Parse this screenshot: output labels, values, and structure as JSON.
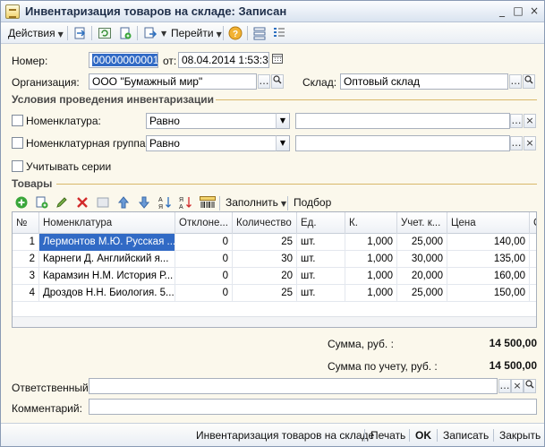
{
  "window": {
    "title": "Инвентаризация товаров на складе: Записан",
    "btn_minimize": "_",
    "btn_maximize": "□",
    "btn_close": "×"
  },
  "toolbar": {
    "actions_label": "Действия",
    "goto_label": "Перейти"
  },
  "header": {
    "number_label": "Номер:",
    "number_value": "00000000001",
    "date_label": "от:",
    "date_value": "08.04.2014  1:53:37",
    "org_label": "Организация:",
    "org_value": "ООО \"Бумажный мир\"",
    "warehouse_label": "Склад:",
    "warehouse_value": "Оптовый склад"
  },
  "conditions": {
    "title": "Условия проведения инвентаризации",
    "nomenclature_label": "Номенклатура:",
    "nomenclature_mode": "Равно",
    "nomenclature_value": "",
    "group_label": "Номенклатурная группа:",
    "group_mode": "Равно",
    "group_value": "",
    "series_label": "Учитывать серии"
  },
  "goods": {
    "title": "Товары",
    "fill_label": "Заполнить",
    "select_label": "Подбор",
    "columns": [
      "№",
      "Номенклатура",
      "Отклоне...",
      "Количество",
      "Ед.",
      "К.",
      "Учет. к...",
      "Цена",
      "С"
    ],
    "rows": [
      {
        "n": "1",
        "name": "Лермонтов М.Ю. Русская ...",
        "dev": "0",
        "qty": "25",
        "unit": "шт.",
        "k": "1,000",
        "acc": "25,000",
        "price": "140,00"
      },
      {
        "n": "2",
        "name": "Карнеги Д. Английский я...",
        "dev": "0",
        "qty": "30",
        "unit": "шт.",
        "k": "1,000",
        "acc": "30,000",
        "price": "135,00"
      },
      {
        "n": "3",
        "name": "Карамзин Н.М. История Р...",
        "dev": "0",
        "qty": "20",
        "unit": "шт.",
        "k": "1,000",
        "acc": "20,000",
        "price": "160,00"
      },
      {
        "n": "4",
        "name": "Дроздов Н.Н. Биология. 5...",
        "dev": "0",
        "qty": "25",
        "unit": "шт.",
        "k": "1,000",
        "acc": "25,000",
        "price": "150,00"
      }
    ]
  },
  "totals": {
    "sum_label": "Сумма, руб. :",
    "sum_value": "14 500,00",
    "acc_sum_label": "Сумма по учету, руб. :",
    "acc_sum_value": "14 500,00"
  },
  "bottom": {
    "responsible_label": "Ответственный:",
    "responsible_value": "",
    "comment_label": "Комментарий:",
    "comment_value": ""
  },
  "footer": {
    "doc_name": "Инвентаризация товаров на складе",
    "print_label": "Печать",
    "ok_label": "OK",
    "save_label": "Записать",
    "close_label": "Закрыть"
  },
  "colors": {
    "selection": "#316ac5",
    "section_accent": "#d9b86a"
  }
}
